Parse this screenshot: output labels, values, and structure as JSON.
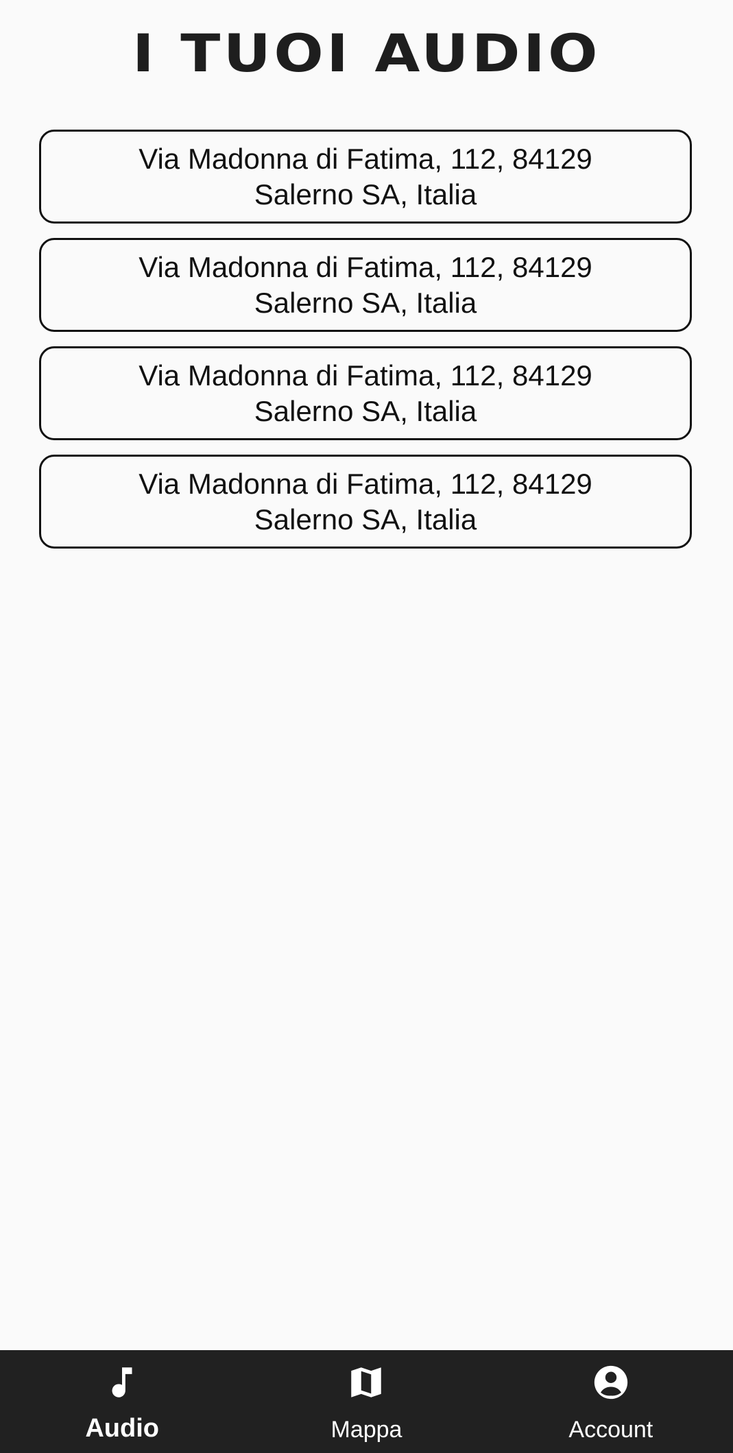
{
  "header": {
    "title": "I TUOI AUDIO"
  },
  "audio_items": [
    {
      "line1": "Via Madonna di Fatima, 112, 84129",
      "line2": "Salerno SA, Italia"
    },
    {
      "line1": "Via Madonna di Fatima, 112, 84129",
      "line2": "Salerno SA, Italia"
    },
    {
      "line1": "Via Madonna di Fatima, 112, 84129",
      "line2": "Salerno SA, Italia"
    },
    {
      "line1": "Via Madonna di Fatima, 112, 84129",
      "line2": "Salerno SA, Italia"
    }
  ],
  "bottom_nav": {
    "tabs": [
      {
        "label": "Audio",
        "icon": "music-note-icon",
        "active": true
      },
      {
        "label": "Mappa",
        "icon": "map-icon",
        "active": false
      },
      {
        "label": "Account",
        "icon": "account-circle-icon",
        "active": false
      }
    ]
  },
  "colors": {
    "background": "#fafafa",
    "nav_background": "#212121",
    "text": "#111111",
    "nav_text": "#ffffff"
  }
}
